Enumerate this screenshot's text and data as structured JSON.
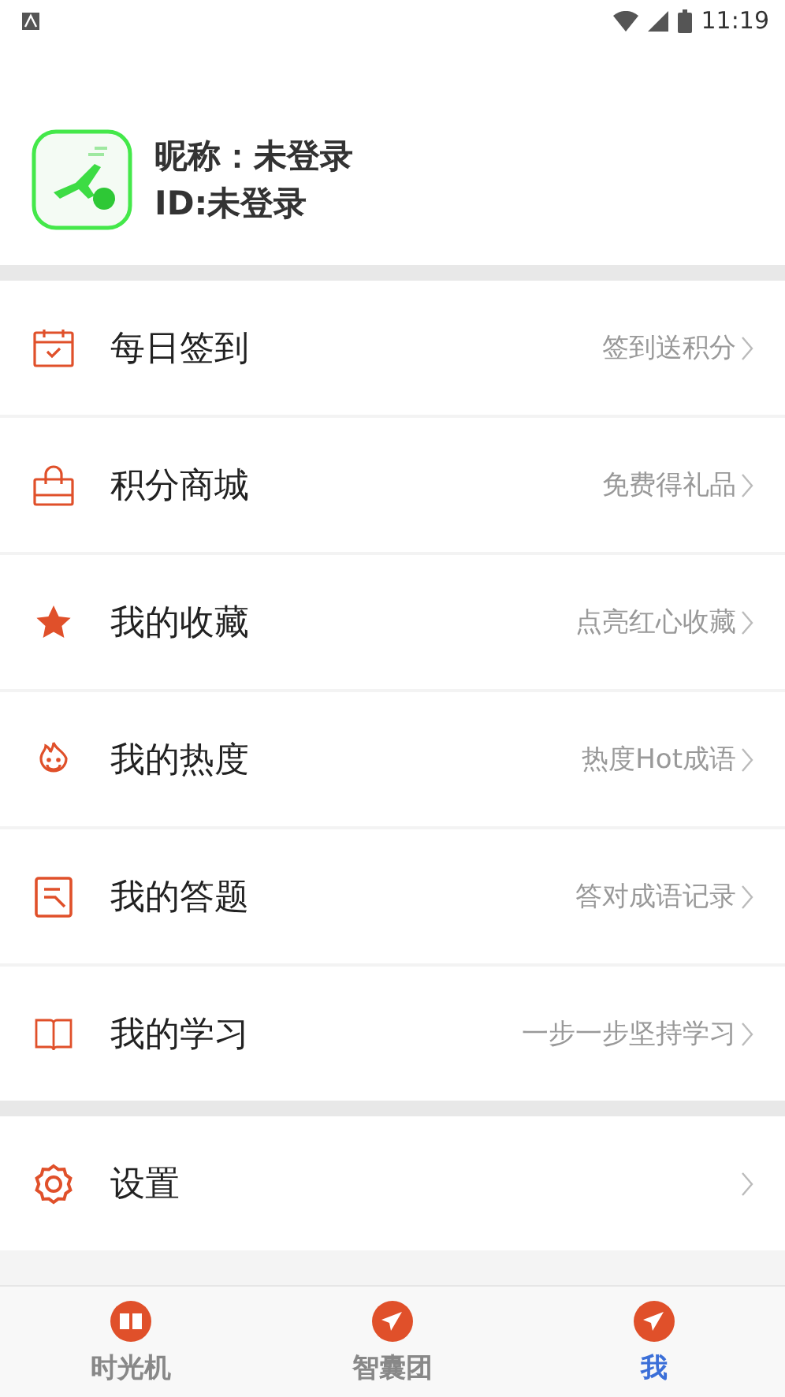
{
  "status_bar": {
    "time": "11:19"
  },
  "profile": {
    "nickname": "昵称：未登录",
    "id": "ID:未登录"
  },
  "menu_groups": [
    {
      "items": [
        {
          "kind": "calendar",
          "label": "每日签到",
          "hint": "签到送积分"
        },
        {
          "kind": "bag",
          "label": "积分商城",
          "hint": "免费得礼品"
        },
        {
          "kind": "star",
          "label": "我的收藏",
          "hint": "点亮红心收藏"
        },
        {
          "kind": "flame",
          "label": "我的热度",
          "hint": "热度Hot成语"
        },
        {
          "kind": "note",
          "label": "我的答题",
          "hint": "答对成语记录"
        },
        {
          "kind": "book",
          "label": "我的学习",
          "hint": "一步一步坚持学习"
        }
      ]
    },
    {
      "items": [
        {
          "kind": "gear",
          "label": "设置"
        }
      ]
    }
  ],
  "tabs": [
    {
      "kind": "book",
      "label": "时光机",
      "selected": false
    },
    {
      "kind": "plane",
      "label": "智囊团",
      "selected": false
    },
    {
      "kind": "plane",
      "label": "我",
      "selected": true
    }
  ]
}
